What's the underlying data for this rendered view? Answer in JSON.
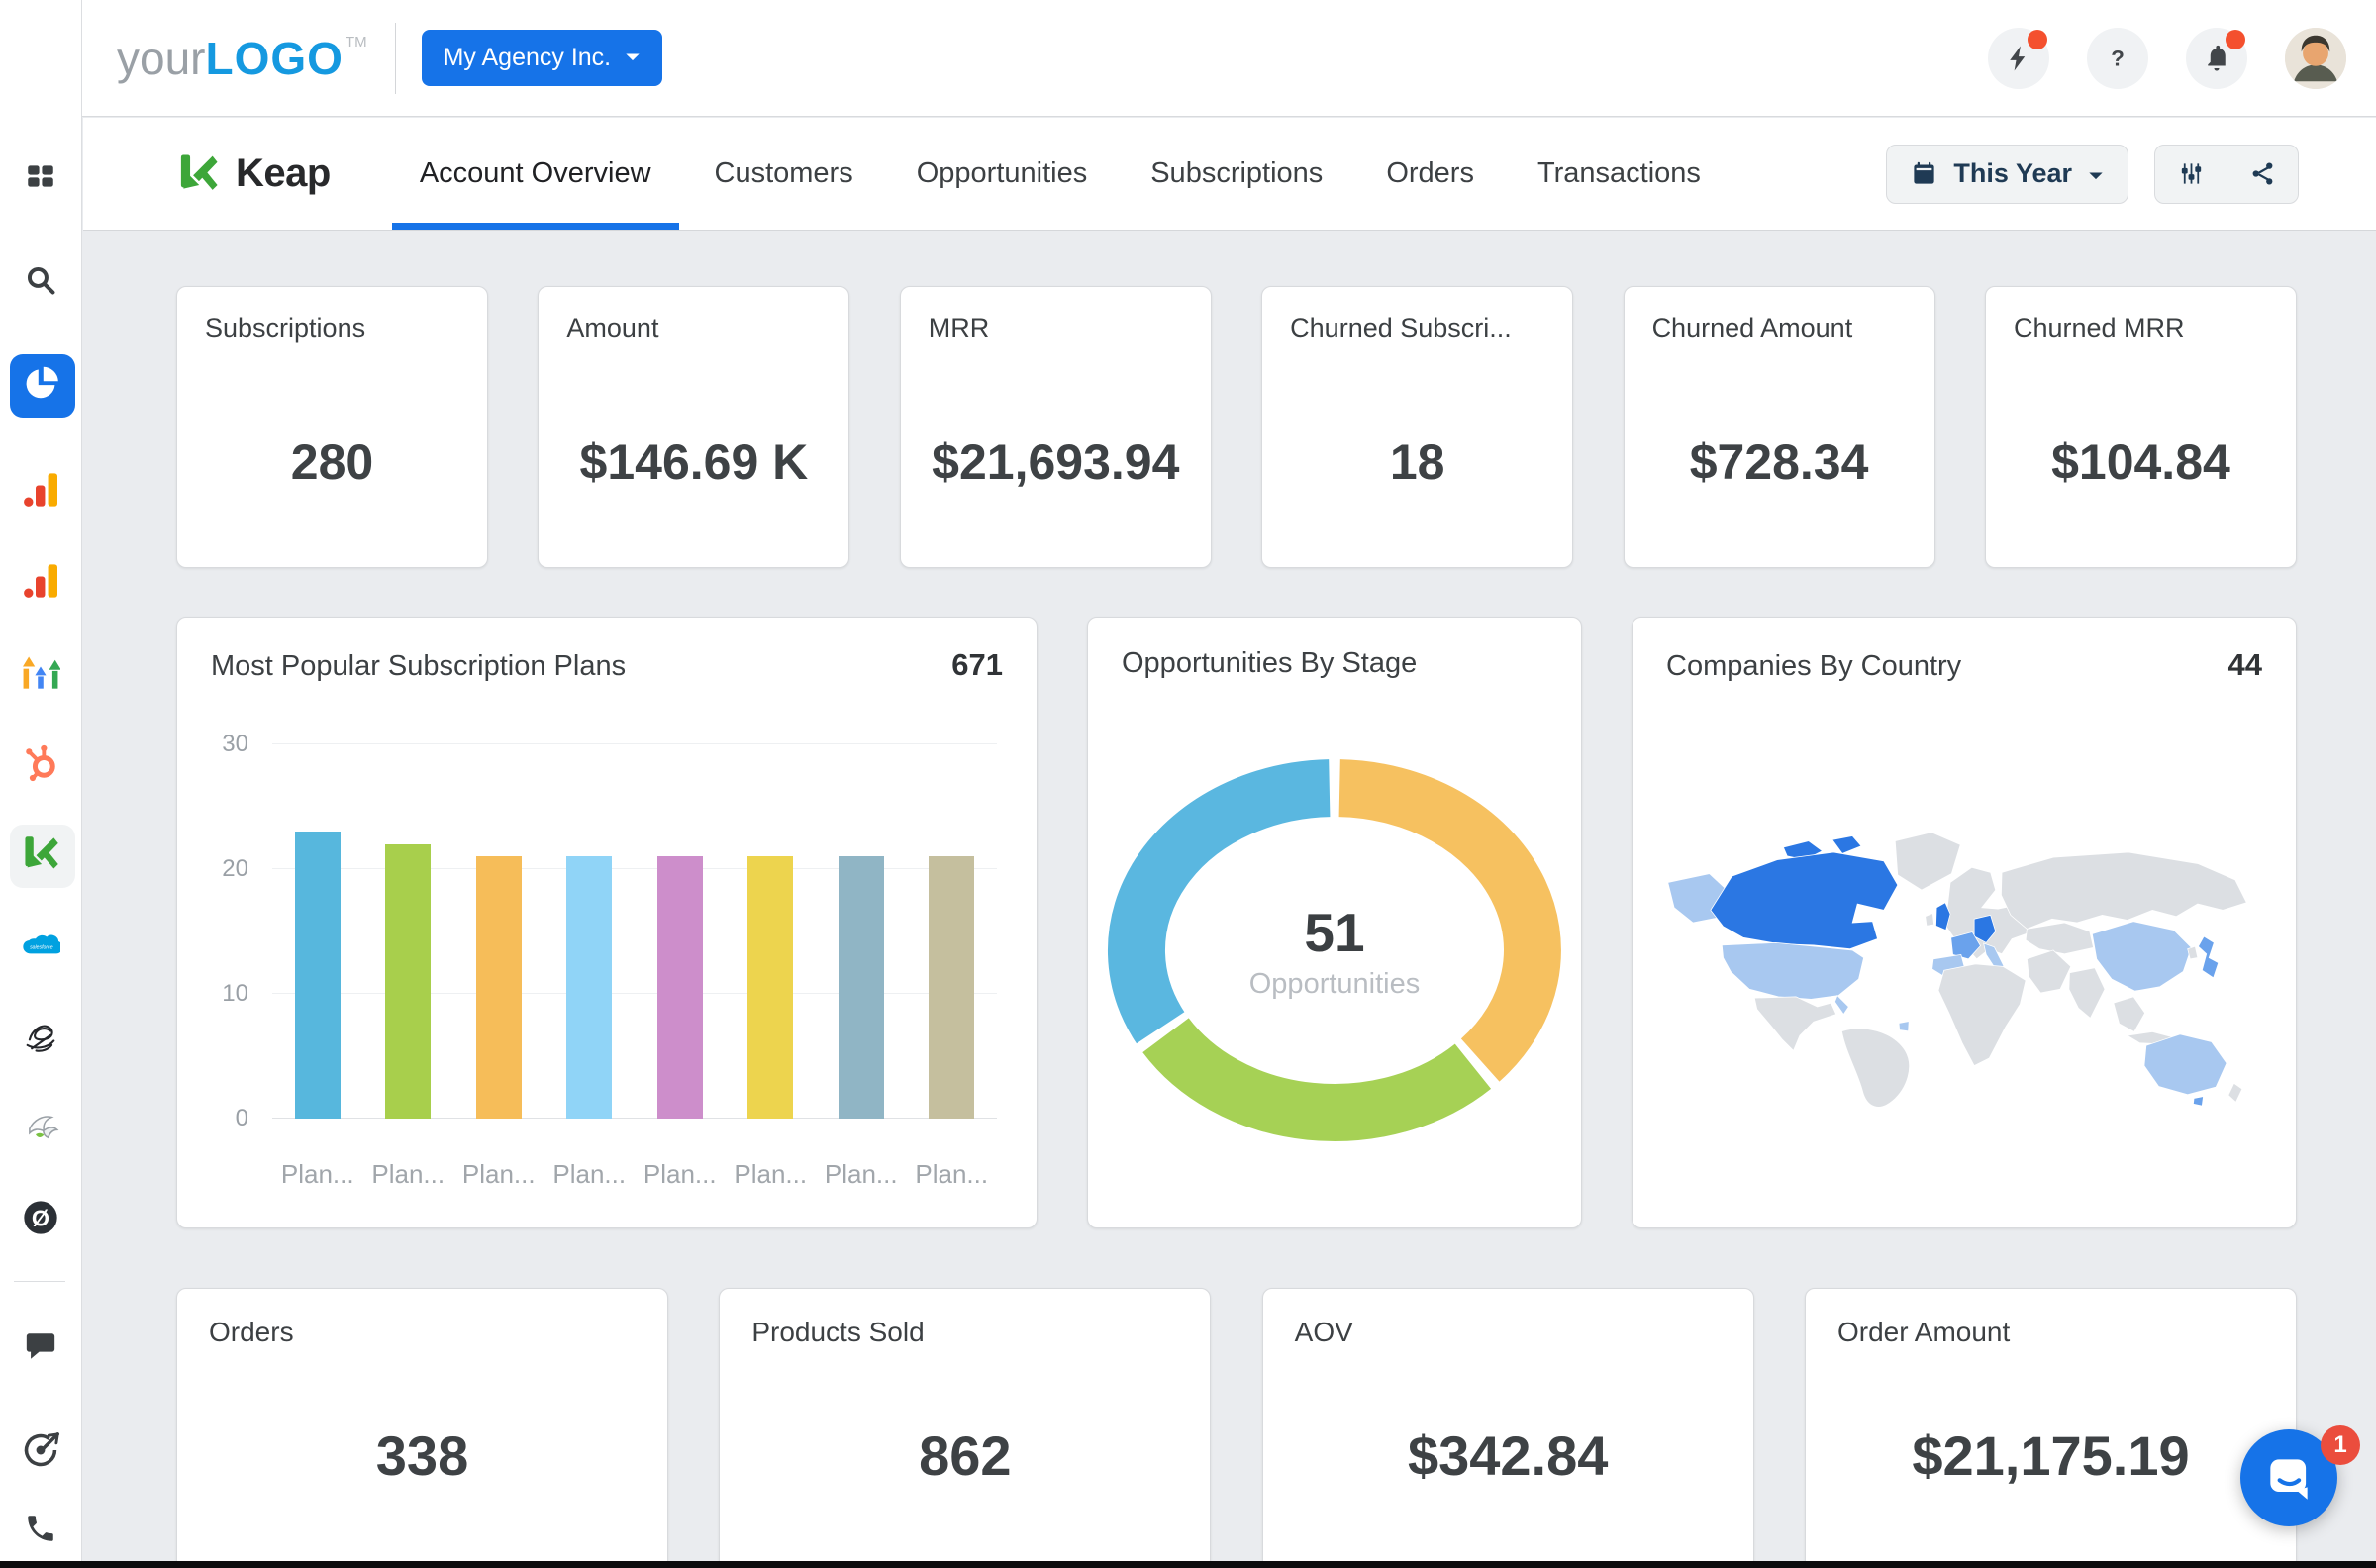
{
  "topbar": {
    "logo_your": "your",
    "logo_brand": "LOGO",
    "logo_tm": "TM",
    "agency_button_label": "My Agency Inc.",
    "action_icons": [
      {
        "name": "boost",
        "icon": "lightning",
        "badge": true
      },
      {
        "name": "help",
        "icon": "question",
        "badge": false
      },
      {
        "name": "notifications",
        "icon": "bell",
        "badge": true
      }
    ]
  },
  "sidebar": {
    "items": [
      {
        "name": "apps-grid",
        "icon": "apps-grid",
        "y": 180
      },
      {
        "name": "search",
        "icon": "search",
        "y": 285
      },
      {
        "name": "dashboard-pie",
        "icon": "pie",
        "y": 390,
        "active": true
      },
      {
        "name": "google-analytics-1",
        "icon": "ga",
        "y": 497
      },
      {
        "name": "google-analytics-2",
        "icon": "ga",
        "y": 589
      },
      {
        "name": "growth-arrows-app",
        "icon": "growth",
        "y": 681
      },
      {
        "name": "hubspot",
        "icon": "hubspot",
        "y": 773
      },
      {
        "name": "keap",
        "icon": "keap",
        "y": 865,
        "selected": true
      },
      {
        "name": "salesforce",
        "icon": "salesforce",
        "y": 957
      },
      {
        "name": "sketch-app",
        "icon": "scribble",
        "y": 1049
      },
      {
        "name": "bird-app",
        "icon": "bird",
        "y": 1140
      },
      {
        "name": "circle-slash-app",
        "icon": "oslash",
        "y": 1232
      },
      {
        "name": "divider",
        "divider": true,
        "y": 1294
      },
      {
        "name": "chat",
        "icon": "chat",
        "y": 1362
      },
      {
        "name": "target-arrow-app",
        "icon": "target",
        "y": 1467
      },
      {
        "name": "phone",
        "icon": "phone",
        "y": 1546
      }
    ]
  },
  "subheader": {
    "source_name": "Keap",
    "tabs": [
      {
        "label": "Account Overview",
        "active": true
      },
      {
        "label": "Customers",
        "active": false
      },
      {
        "label": "Opportunities",
        "active": false
      },
      {
        "label": "Subscriptions",
        "active": false
      },
      {
        "label": "Orders",
        "active": false
      },
      {
        "label": "Transactions",
        "active": false
      }
    ],
    "date_range_label": "This Year"
  },
  "kpi_cards": [
    {
      "label": "Subscriptions",
      "value": "280"
    },
    {
      "label": "Amount",
      "value": "$146.69 K"
    },
    {
      "label": "MRR",
      "value": "$21,693.94"
    },
    {
      "label": "Churned Subscri...",
      "value": "18"
    },
    {
      "label": "Churned Amount",
      "value": "$728.34"
    },
    {
      "label": "Churned MRR",
      "value": "$104.84"
    }
  ],
  "bottom_cards": [
    {
      "label": "Orders",
      "value": "338"
    },
    {
      "label": "Products Sold",
      "value": "862"
    },
    {
      "label": "AOV",
      "value": "$342.84"
    },
    {
      "label": "Order Amount",
      "value": "$21,175.19"
    }
  ],
  "chart_data": [
    {
      "id": "subscription_plans",
      "type": "bar",
      "title": "Most Popular Subscription Plans",
      "total": "671",
      "categories": [
        "Plan...",
        "Plan...",
        "Plan...",
        "Plan...",
        "Plan...",
        "Plan...",
        "Plan...",
        "Plan..."
      ],
      "values": [
        23,
        22,
        21,
        21,
        21,
        21,
        21,
        21
      ],
      "colors": [
        "#57b7dd",
        "#a8cf4c",
        "#f6bd59",
        "#90d4f7",
        "#cd8ecb",
        "#edd44e",
        "#90b5c5",
        "#c5bf9e"
      ],
      "ylim": [
        0,
        30
      ],
      "yticks": [
        0,
        10,
        20,
        30
      ],
      "grid": true,
      "xlabel": "",
      "ylabel": ""
    },
    {
      "id": "opportunities_by_stage",
      "type": "donut",
      "title": "Opportunities By Stage",
      "center_value": "51",
      "center_label": "Opportunities",
      "segments": [
        {
          "value": 19,
          "color": "#f6c160"
        },
        {
          "value": 15,
          "color": "#a6d155"
        },
        {
          "value": 17,
          "color": "#5ab7e0"
        }
      ]
    },
    {
      "id": "companies_by_country",
      "type": "choropleth",
      "title": "Companies By Country",
      "total": "44",
      "palette": {
        "land": "#dcdfe3",
        "high": "#2b77e3",
        "medium": "#6aa2ec",
        "low": "#a8c8f0"
      },
      "countries": [
        {
          "name": "canada",
          "intensity": "high"
        },
        {
          "name": "united-kingdom",
          "intensity": "high"
        },
        {
          "name": "germany",
          "intensity": "high"
        },
        {
          "name": "france",
          "intensity": "medium"
        },
        {
          "name": "japan",
          "intensity": "medium"
        },
        {
          "name": "tasmania",
          "intensity": "medium"
        },
        {
          "name": "alaska",
          "intensity": "low"
        },
        {
          "name": "united-states",
          "intensity": "low"
        },
        {
          "name": "spain",
          "intensity": "low"
        },
        {
          "name": "italy",
          "intensity": "low"
        },
        {
          "name": "china",
          "intensity": "low"
        },
        {
          "name": "australia",
          "intensity": "low"
        },
        {
          "name": "guiana",
          "intensity": "low"
        }
      ]
    }
  ],
  "intercom": {
    "badge": "1"
  },
  "colors": {
    "accent_blue": "#1673e8",
    "badge_orange": "#f4502e",
    "intercom_red": "#eb4d3d"
  }
}
